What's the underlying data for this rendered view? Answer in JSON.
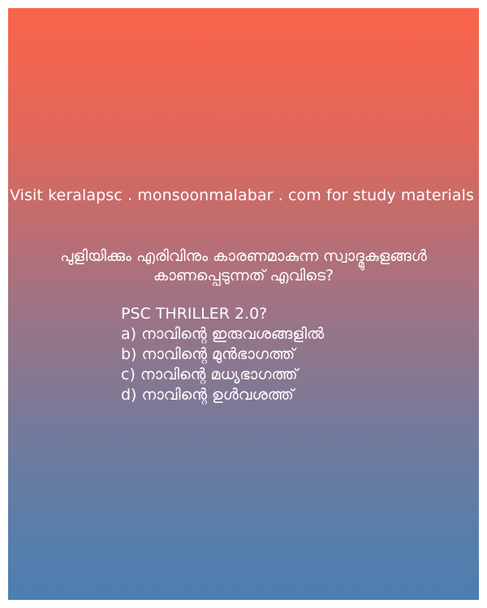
{
  "banner": {
    "visit_text": "Visit keralapsc . monsoonmalabar . com for study materials"
  },
  "quiz": {
    "question_line1": "പുളിയിക്കും എരിവിനും കാരണമാകുന്ന സ്വാദ്മുകുളങ്ങൾ",
    "question_line2": "കാണപ്പെടുന്നത് എവിടെ?",
    "series_label": "PSC THRILLER 2.0?",
    "options": [
      "a) നാവിന്റെ ഇരുവശങ്ങളിൽ",
      "b) നാവിന്റെ മുൻഭാഗത്ത്",
      "c) നാവിന്റെ മധ്യഭാഗത്ത്",
      "d) നാവിന്റെ ഉൾവശത്ത്"
    ]
  },
  "colors": {
    "gradient_top": "#fb644a",
    "gradient_bottom": "#4a7fb2",
    "text": "#ffffff"
  }
}
